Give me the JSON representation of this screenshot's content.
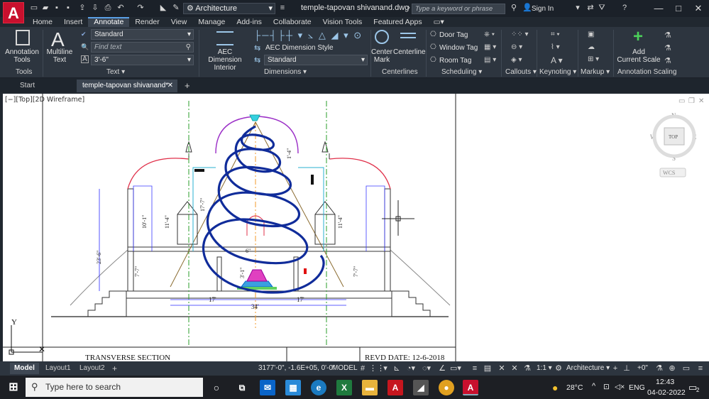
{
  "app": {
    "logo": "A",
    "workspace": "Architecture",
    "document_title": "temple-tapovan shivanand.dwg",
    "search_placeholder": "Type a keyword or phrase",
    "sign_in": "Sign In"
  },
  "menu_tabs": [
    "Home",
    "Insert",
    "Annotate",
    "Render",
    "View",
    "Manage",
    "Add-ins",
    "Collaborate",
    "Vision Tools",
    "Featured Apps"
  ],
  "ribbon": {
    "tools": {
      "button": "Annotation\nTools",
      "panel": "Tools"
    },
    "text": {
      "multiline": "Multiline\nText",
      "style": "Standard",
      "find_placeholder": "Find text",
      "height": "3'-6\"",
      "panel": "Text"
    },
    "dimensions": {
      "aec_dimension": "AEC Dimension\nInterior",
      "aec_style": "AEC Dimension Style",
      "dim_style": "Standard",
      "panel": "Dimensions"
    },
    "centerlines": {
      "center_mark": "Center\nMark",
      "centerline": "Centerline",
      "panel": "Centerlines"
    },
    "scheduling": {
      "door_tag": "Door Tag",
      "window_tag": "Window Tag",
      "room_tag": "Room Tag",
      "panel": "Scheduling"
    },
    "callouts": {
      "panel": "Callouts"
    },
    "keynoting": {
      "panel": "Keynoting"
    },
    "markup": {
      "panel": "Markup"
    },
    "annotation_scaling": {
      "button": "Add\nCurrent Scale",
      "panel": "Annotation Scaling"
    }
  },
  "file_tabs": {
    "start": "Start",
    "active": "temple-tapovan shivanand*"
  },
  "viewport": {
    "label": "[−][Top][2D Wireframe]",
    "viewcube": {
      "top": "TOP",
      "n": "N",
      "s": "S",
      "e": "E",
      "w": "W",
      "wcs": "WCS"
    },
    "ucs_y": "Y"
  },
  "drawing": {
    "dims": {
      "d1": "17'",
      "d2": "17'",
      "d3": "34'",
      "d4": "23'-6\"",
      "d5": "7'-7\"",
      "d6": "7'-7\"",
      "d7": "11'-4\"",
      "d8": "11'-4\"",
      "d9": "10'-1\"",
      "d10": "17'-7\"",
      "d11": "1'-4\"",
      "d12": "6\"",
      "d13": "3'-1\""
    },
    "section_title": "TRANSVERSE SECTION",
    "revd_date": "REVD DATE: 12-6-2018"
  },
  "layout_tabs": [
    "Model",
    "Layout1",
    "Layout2"
  ],
  "status": {
    "coords": "3177'-0\", -1.6E+05, 0'-0\"",
    "mode": "MODEL",
    "scale": "1:1",
    "workspace": "Architecture",
    "elev": "+0\""
  },
  "taskbar": {
    "search_placeholder": "Type here to search",
    "temperature": "28°C",
    "language": "ENG",
    "time": "12:43",
    "date": "04-02-2022",
    "notifications": "2"
  }
}
